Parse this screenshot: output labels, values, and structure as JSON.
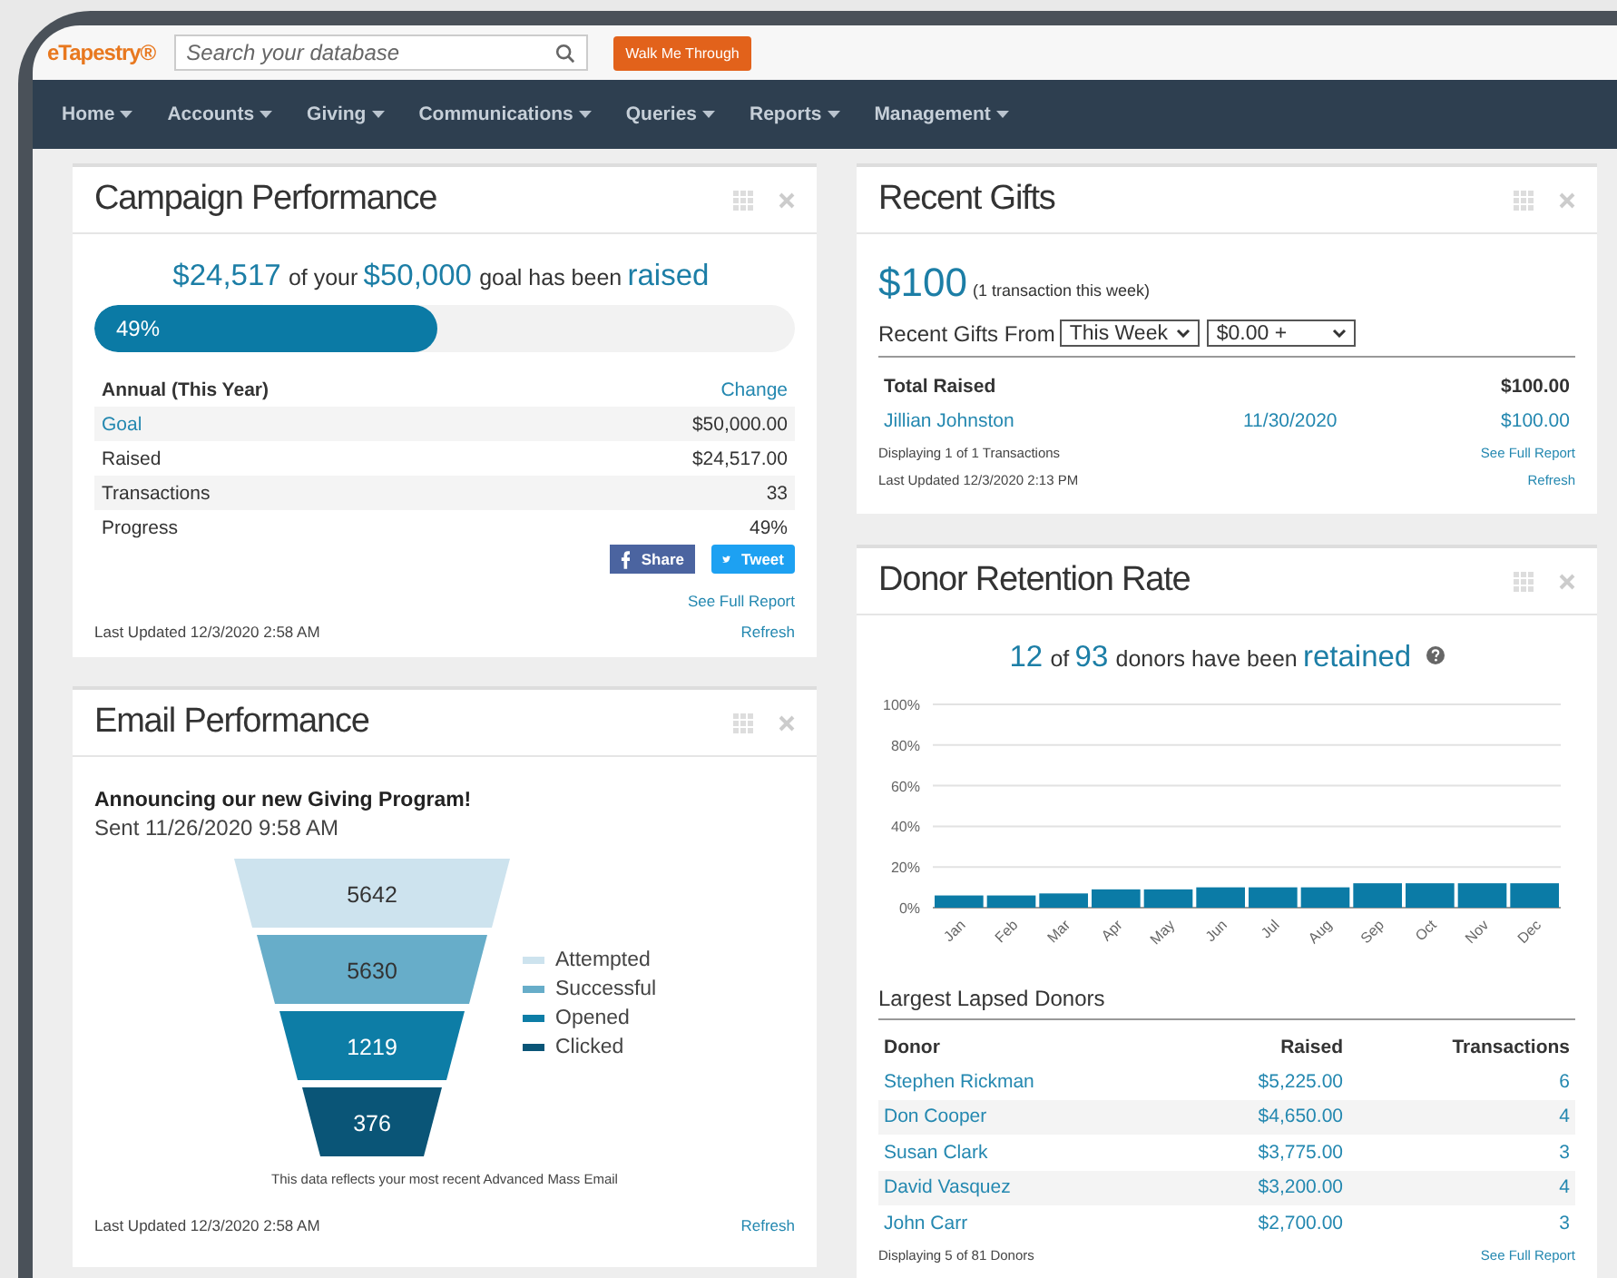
{
  "header": {
    "logo": "eTapestry®",
    "search": {
      "placeholder": "Search your database"
    },
    "walk_button": "Walk Me Through"
  },
  "nav": {
    "items": [
      "Home",
      "Accounts",
      "Giving",
      "Communications",
      "Queries",
      "Reports",
      "Management"
    ]
  },
  "campaign": {
    "title": "Campaign Performance",
    "headline": [
      {
        "text": "$24,517",
        "kind": "figure"
      },
      {
        "text": "of your",
        "kind": "plain"
      },
      {
        "text": "$50,000",
        "kind": "figure"
      },
      {
        "text": "goal has been",
        "kind": "plain"
      },
      {
        "text": "raised",
        "kind": "figure"
      }
    ],
    "progress": {
      "label": "49%",
      "level": 0.49
    },
    "table_heading": "Annual (This Year)",
    "change_link": "Change",
    "rows": [
      {
        "label": "Goal",
        "value": "$50,000.00",
        "kind": "link"
      },
      {
        "label": "Raised",
        "value": "$24,517.00",
        "kind": "plain"
      },
      {
        "label": "Transactions",
        "value": "33",
        "kind": "plain"
      },
      {
        "label": "Progress",
        "value": "49%",
        "kind": "plain"
      }
    ],
    "share_button": "Share",
    "tweet_button": "Tweet",
    "full_report": "See Full Report",
    "updated": "Last Updated 12/3/2020 2:58 AM",
    "refresh": "Refresh"
  },
  "email": {
    "title": "Email Performance",
    "subject": "Announcing our new Giving Program!",
    "sent": "Sent  11/26/2020 9:58 AM",
    "funnel": [
      {
        "value": "5642",
        "label": "Attempted",
        "color": "#cde3ee"
      },
      {
        "value": "5630",
        "label": "Successful",
        "color": "#67adc9"
      },
      {
        "value": "1219",
        "label": "Opened",
        "color": "#0d7da6"
      },
      {
        "value": "376",
        "label": "Clicked",
        "color": "#0a5577"
      }
    ],
    "caption": "This data reflects your most recent Advanced Mass Email",
    "updated": "Last Updated 12/3/2020 2:58 AM",
    "refresh": "Refresh"
  },
  "gifts": {
    "title": "Recent Gifts",
    "amount": "$100",
    "amount_note": "(1 transaction this week)",
    "filter_label": "Recent Gifts From",
    "period": "This Week",
    "min_amount": "$0.00 +",
    "total_label": "Total Raised",
    "total_value": "$100.00",
    "rows": [
      {
        "donor": "Jillian Johnston",
        "date": "11/30/2020",
        "amount": "$100.00"
      }
    ],
    "displaying": "Displaying 1 of 1 Transactions",
    "full_report": "See Full Report",
    "updated": "Last Updated 12/3/2020 2:13 PM",
    "refresh": "Refresh"
  },
  "retention": {
    "title": "Donor Retention Rate",
    "headline": [
      {
        "text": "12",
        "kind": "figure"
      },
      {
        "text": "of",
        "kind": "plain"
      },
      {
        "text": "93",
        "kind": "figure"
      },
      {
        "text": "donors have been",
        "kind": "plain"
      },
      {
        "text": "retained",
        "kind": "figure"
      }
    ],
    "chart_data": {
      "type": "bar",
      "categories": [
        "Jan",
        "Feb",
        "Mar",
        "Apr",
        "May",
        "Jun",
        "Jul",
        "Aug",
        "Sep",
        "Oct",
        "Nov",
        "Dec"
      ],
      "values": [
        6,
        6,
        7,
        9,
        9,
        10,
        10,
        10,
        12,
        12,
        12,
        12
      ],
      "grid": true,
      "ylim": [
        0,
        100
      ],
      "yticks": [
        {
          "value": 0,
          "label": "0%"
        },
        {
          "value": 20,
          "label": "20%"
        },
        {
          "value": 40,
          "label": "40%"
        },
        {
          "value": 60,
          "label": "60%"
        },
        {
          "value": 80,
          "label": "80%"
        },
        {
          "value": 100,
          "label": "100%"
        }
      ]
    },
    "lapsed_title": "Largest Lapsed Donors",
    "columns": [
      "Donor",
      "Raised",
      "Transactions"
    ],
    "rows": [
      {
        "donor": "Stephen Rickman",
        "raised": "$5,225.00",
        "transactions": "6"
      },
      {
        "donor": "Don Cooper",
        "raised": "$4,650.00",
        "transactions": "4"
      },
      {
        "donor": "Susan Clark",
        "raised": "$3,775.00",
        "transactions": "3"
      },
      {
        "donor": "David Vasquez",
        "raised": "$3,200.00",
        "transactions": "4"
      },
      {
        "donor": "John Carr",
        "raised": "$2,700.00",
        "transactions": "3"
      }
    ],
    "displaying": "Displaying 5 of 81 Donors",
    "full_report": "See Full Report"
  }
}
